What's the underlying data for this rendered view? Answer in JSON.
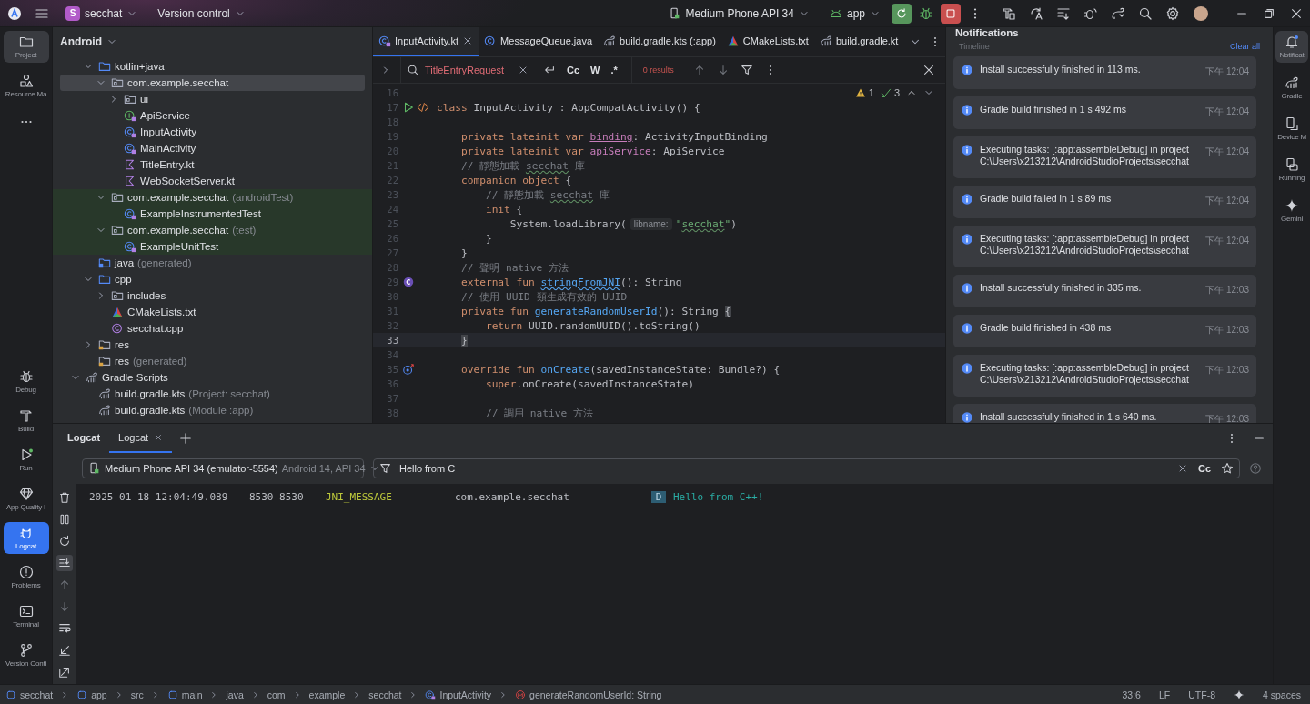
{
  "top_bar": {
    "project_badge": "S",
    "project": "secchat",
    "vcs": "Version control",
    "device": "Medium Phone API 34",
    "run_config": "app"
  },
  "left_tools": {
    "top": [
      {
        "label": "Project",
        "selected": true
      },
      {
        "label": "Resource Ma",
        "selected": false
      }
    ],
    "bottom": [
      {
        "label": "Debug",
        "selected": false
      },
      {
        "label": "Build",
        "selected": false
      },
      {
        "label": "Run",
        "selected": false
      },
      {
        "label": "App Quality I",
        "selected": false
      },
      {
        "label": "Logcat",
        "selected": true
      },
      {
        "label": "Problems",
        "selected": false
      },
      {
        "label": "Terminal",
        "selected": false
      },
      {
        "label": "Version Conti",
        "selected": false
      }
    ]
  },
  "project_panel": {
    "view": "Android",
    "tree": [
      {
        "children": [
          {
            "label": "kotlin+java",
            "kind": "folder",
            "expanded": true,
            "selected": false,
            "children": [
              {
                "label": "com.example.secchat",
                "kind": "package",
                "expanded": true,
                "selected": true,
                "children": [
                  {
                    "label": "ui",
                    "kind": "package",
                    "expanded": false,
                    "selected": false
                  },
                  {
                    "label": "ApiService",
                    "kind": "interface",
                    "selected": false
                  },
                  {
                    "label": "InputActivity",
                    "kind": "class",
                    "selected": false
                  },
                  {
                    "label": "MainActivity",
                    "kind": "class",
                    "selected": false
                  },
                  {
                    "label": "TitleEntry.kt",
                    "kind": "kotlin",
                    "selected": false
                  },
                  {
                    "label": "WebSocketServer.kt",
                    "kind": "kotlin",
                    "selected": false
                  }
                ]
              },
              {
                "label": "com.example.secchat",
                "note": "(androidTest)",
                "kind": "package",
                "test_scope": true,
                "expanded": true,
                "selected": false,
                "children": [
                  {
                    "label": "ExampleInstrumentedTest",
                    "kind": "class",
                    "selected": false
                  }
                ]
              },
              {
                "label": "com.example.secchat",
                "note": "(test)",
                "kind": "package",
                "test_scope": true,
                "expanded": true,
                "selected": false,
                "children": [
                  {
                    "label": "ExampleUnitTest",
                    "kind": "class",
                    "selected": false
                  }
                ]
              }
            ]
          },
          {
            "label": "java",
            "note": "(generated)",
            "kind": "gen-folder",
            "selected": false
          },
          {
            "label": "cpp",
            "kind": "folder",
            "expanded": true,
            "selected": false,
            "children": [
              {
                "label": "includes",
                "kind": "package",
                "expanded": false,
                "selected": false
              },
              {
                "label": "CMakeLists.txt",
                "kind": "cmake",
                "selected": false
              },
              {
                "label": "secchat.cpp",
                "kind": "cpp",
                "selected": false
              }
            ]
          },
          {
            "label": "res",
            "kind": "res-folder",
            "expanded": false,
            "selected": false
          },
          {
            "label": "res",
            "note": "(generated)",
            "kind": "res-folder",
            "selected": false
          }
        ]
      },
      {
        "label": "Gradle Scripts",
        "kind": "gradle",
        "expanded": true,
        "selected": false,
        "children": [
          {
            "label": "build.gradle.kts",
            "note": "(Project: secchat)",
            "kind": "gradle",
            "selected": false
          },
          {
            "label": "build.gradle.kts",
            "note": "(Module :app)",
            "kind": "gradle",
            "selected": false
          }
        ]
      }
    ]
  },
  "editor": {
    "tabs": [
      {
        "label": "InputActivity.kt",
        "kind": "kotlin-class",
        "selected": true,
        "closable": true
      },
      {
        "label": "MessageQueue.java",
        "kind": "java-class",
        "selected": false,
        "closable": false
      },
      {
        "label": "build.gradle.kts (:app)",
        "kind": "gradle",
        "selected": false,
        "closable": false
      },
      {
        "label": "CMakeLists.txt",
        "kind": "cmake",
        "selected": false,
        "closable": false
      },
      {
        "label": "build.gradle.kt",
        "kind": "gradle",
        "selected": false,
        "closable": false
      }
    ],
    "find": {
      "query": "TitleEntryRequest",
      "options": [
        "Cc",
        "W",
        ".*"
      ],
      "results": "0 results"
    },
    "inspections": {
      "warnings": "1",
      "checks": "3"
    },
    "lines": [
      {
        "n": "16",
        "current": false
      },
      {
        "n": "17",
        "current": false,
        "gutter": [
          {
            "kind": "run"
          },
          {
            "kind": "layout"
          }
        ],
        "parts": [
          {
            "kind": "keyword",
            "text": "class "
          },
          {
            "kind": "plain",
            "text": "InputActivity : AppCompatActivity() {"
          }
        ]
      },
      {
        "n": "18",
        "current": false
      },
      {
        "n": "19",
        "current": false,
        "parts": [
          {
            "kind": "keyword",
            "text": "    private lateinit var "
          },
          {
            "kind": "property",
            "text": "binding"
          },
          {
            "kind": "plain",
            "text": ": ActivityInputBinding"
          }
        ]
      },
      {
        "n": "20",
        "current": false,
        "parts": [
          {
            "kind": "keyword",
            "text": "    private lateinit var "
          },
          {
            "kind": "property",
            "text": "apiService"
          },
          {
            "kind": "plain",
            "text": ": ApiService"
          }
        ]
      },
      {
        "n": "21",
        "current": false,
        "parts": [
          {
            "kind": "comment",
            "text": "    // 靜態加載 "
          },
          {
            "kind": "typo-comment",
            "text": "secchat"
          },
          {
            "kind": "comment",
            "text": " 庫"
          }
        ]
      },
      {
        "n": "22",
        "current": false,
        "parts": [
          {
            "kind": "keyword",
            "text": "    companion object "
          },
          {
            "kind": "plain",
            "text": "{"
          }
        ]
      },
      {
        "n": "23",
        "current": false,
        "parts": [
          {
            "kind": "comment",
            "text": "        // 靜態加載 "
          },
          {
            "kind": "typo-comment",
            "text": "secchat"
          },
          {
            "kind": "comment",
            "text": " 庫"
          }
        ]
      },
      {
        "n": "24",
        "current": false,
        "parts": [
          {
            "kind": "keyword",
            "text": "        init "
          },
          {
            "kind": "plain",
            "text": "{"
          }
        ]
      },
      {
        "n": "25",
        "current": false,
        "parts": [
          {
            "kind": "plain",
            "text": "            System.loadLibrary("
          },
          {
            "kind": "hint",
            "text": "libname:"
          },
          {
            "kind": "string",
            "text": "\""
          },
          {
            "kind": "typo-string",
            "text": "secchat"
          },
          {
            "kind": "string",
            "text": "\""
          },
          {
            "kind": "plain",
            "text": ")"
          }
        ]
      },
      {
        "n": "26",
        "current": false,
        "parts": [
          {
            "kind": "plain",
            "text": "        }"
          }
        ]
      },
      {
        "n": "27",
        "current": false,
        "parts": [
          {
            "kind": "plain",
            "text": "    }"
          }
        ]
      },
      {
        "n": "28",
        "current": false,
        "parts": [
          {
            "kind": "comment",
            "text": "    // 聲明 native 方法"
          }
        ]
      },
      {
        "n": "29",
        "current": false,
        "gutter": [
          {
            "kind": "native"
          }
        ],
        "parts": [
          {
            "kind": "keyword",
            "text": "    external fun "
          },
          {
            "kind": "typo-function",
            "text": "stringFromJNI"
          },
          {
            "kind": "plain",
            "text": "(): String"
          }
        ]
      },
      {
        "n": "30",
        "current": false,
        "parts": [
          {
            "kind": "comment",
            "text": "    // 使用 UUID 類生成有效的 UUID"
          }
        ]
      },
      {
        "n": "31",
        "current": false,
        "parts": [
          {
            "kind": "keyword",
            "text": "    private fun "
          },
          {
            "kind": "function",
            "text": "generateRandomUserId"
          },
          {
            "kind": "plain",
            "text": "(): String "
          },
          {
            "kind": "brace",
            "text": "{"
          }
        ]
      },
      {
        "n": "32",
        "current": false,
        "parts": [
          {
            "kind": "keyword",
            "text": "        return "
          },
          {
            "kind": "plain",
            "text": "UUID.randomUUID().toString()"
          }
        ]
      },
      {
        "n": "33",
        "current": true,
        "parts": [
          {
            "kind": "brace",
            "text": "    }"
          }
        ]
      },
      {
        "n": "34",
        "current": false
      },
      {
        "n": "35",
        "current": false,
        "gutter": [
          {
            "kind": "override"
          }
        ],
        "parts": [
          {
            "kind": "keyword",
            "text": "    override fun "
          },
          {
            "kind": "function",
            "text": "onCreate"
          },
          {
            "kind": "plain",
            "text": "(savedInstanceState: Bundle?) {"
          }
        ]
      },
      {
        "n": "36",
        "current": false,
        "parts": [
          {
            "kind": "keyword",
            "text": "        super"
          },
          {
            "kind": "plain",
            "text": ".onCreate(savedInstanceState)"
          }
        ]
      },
      {
        "n": "37",
        "current": false
      },
      {
        "n": "38",
        "current": false,
        "parts": [
          {
            "kind": "comment",
            "text": "        // 調用 native 方法"
          }
        ]
      }
    ]
  },
  "notifications": {
    "title": "Notifications",
    "section": "Timeline",
    "clear": "Clear all",
    "items": [
      {
        "text": "Install successfully finished in 113 ms.",
        "time": "下午 12:04"
      },
      {
        "text": "Gradle build finished in 1 s 492 ms",
        "time": "下午 12:04"
      },
      {
        "text": "Executing tasks: [:app:assembleDebug] in project C:\\Users\\x213212\\AndroidStudioProjects\\secchat",
        "time": "下午 12:04"
      },
      {
        "text": "Gradle build failed in 1 s 89 ms",
        "time": "下午 12:04"
      },
      {
        "text": "Executing tasks: [:app:assembleDebug] in project C:\\Users\\x213212\\AndroidStudioProjects\\secchat",
        "time": "下午 12:04"
      },
      {
        "text": "Install successfully finished in 335 ms.",
        "time": "下午 12:03"
      },
      {
        "text": "Gradle build finished in 438 ms",
        "time": "下午 12:03"
      },
      {
        "text": "Executing tasks: [:app:assembleDebug] in project C:\\Users\\x213212\\AndroidStudioProjects\\secchat",
        "time": "下午 12:03"
      },
      {
        "text": "Install successfully finished in 1 s 640 ms.",
        "time": "下午 12:03"
      }
    ]
  },
  "right_tools": [
    {
      "label": "Notificat",
      "selected": true
    },
    {
      "label": "Gradle",
      "selected": false
    },
    {
      "label": "Device M",
      "selected": false
    },
    {
      "label": "Running",
      "selected": false
    },
    {
      "label": "Gemini",
      "selected": false
    }
  ],
  "logcat": {
    "tabs": [
      {
        "label": "Logcat",
        "selected": false,
        "closable": false
      },
      {
        "label": "Logcat",
        "selected": true,
        "closable": true
      }
    ],
    "device": {
      "name": "Medium Phone API 34 (emulator-5554)",
      "detail": "Android 14, API 34"
    },
    "filter": "Hello from C",
    "case_option": "Cc",
    "rows": [
      {
        "date": "2025-01-18 12:04:49.089",
        "pid": "8530-8530",
        "tag": "JNI_MESSAGE",
        "package": "com.example.secchat",
        "level": "D",
        "message": "Hello from C++!"
      }
    ]
  },
  "status_bar": {
    "path": [
      {
        "label": "secchat",
        "kind": "module"
      },
      {
        "label": "app",
        "kind": "module"
      },
      {
        "label": "src",
        "kind": "plain"
      },
      {
        "label": "main",
        "kind": "module"
      },
      {
        "label": "java",
        "kind": "plain"
      },
      {
        "label": "com",
        "kind": "plain"
      },
      {
        "label": "example",
        "kind": "plain"
      },
      {
        "label": "secchat",
        "kind": "plain"
      },
      {
        "label": "InputActivity",
        "kind": "class"
      },
      {
        "label": "generateRandomUserId: String",
        "kind": "method"
      }
    ],
    "position": "33:6",
    "line_ending": "LF",
    "encoding": "UTF-8",
    "indent": "4 spaces"
  }
}
